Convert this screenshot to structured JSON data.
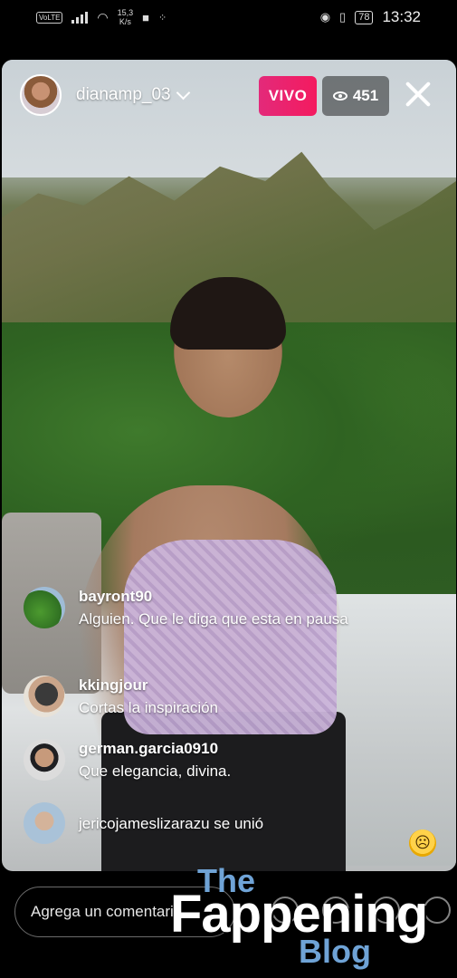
{
  "status_bar": {
    "volte": "VoLTE",
    "speed_value": "15,3",
    "speed_unit": "K/s",
    "battery": "78",
    "time": "13:32"
  },
  "live": {
    "username": "dianamp_03",
    "live_badge": "VIVO",
    "viewer_count": "451",
    "colors": {
      "live_badge": "#f0286a"
    }
  },
  "comments": [
    {
      "user": "bayront90",
      "text": "Alguien. Que le diga que esta en pausa"
    },
    {
      "user": "kkingjour",
      "text": "Cortas la inspiración"
    },
    {
      "user": "german.garcia0910",
      "text": "Que elegancia, divina."
    }
  ],
  "join_notice": "jericojameslizarazu se unió",
  "bottom": {
    "comment_placeholder": "Agrega un comentario..."
  },
  "watermark": {
    "line1": "The",
    "line2": "Fappening",
    "line3": "Blog"
  }
}
